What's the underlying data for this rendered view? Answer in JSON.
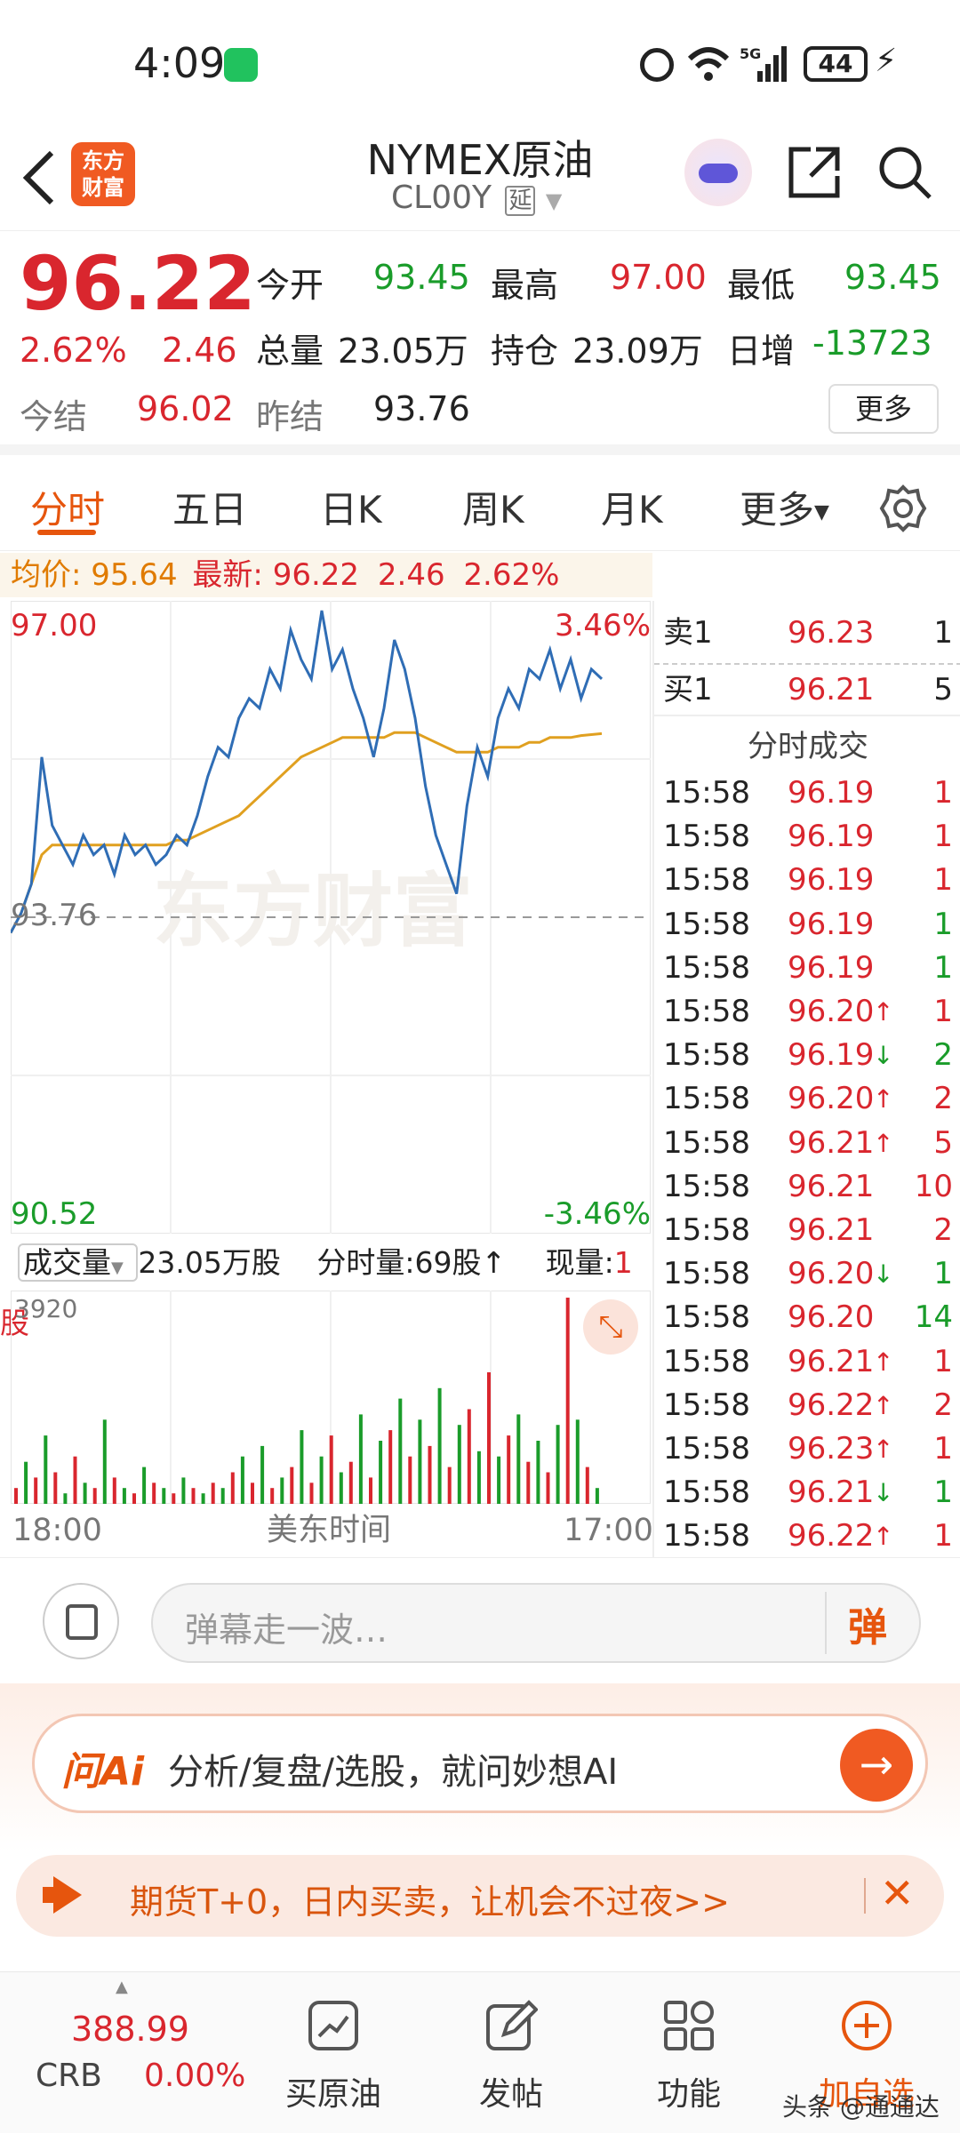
{
  "status": {
    "time": "4:09",
    "battery": "44"
  },
  "nav": {
    "logo_line1": "东方",
    "logo_line2": "财富",
    "title": "NYMEX原油",
    "subtitle": "CL00Y",
    "delay_tag": "延"
  },
  "quote": {
    "price": "96.22",
    "change_pct": "2.62%",
    "change": "2.46",
    "open_label": "今开",
    "open": "93.45",
    "high_label": "最高",
    "high": "97.00",
    "low_label": "最低",
    "low": "93.45",
    "volume_label": "总量",
    "volume": "23.05万",
    "oi_label": "持仓",
    "oi": "23.09万",
    "daily_inc_label": "日增",
    "daily_inc": "-13723",
    "settle_label": "今结",
    "settle": "96.02",
    "prev_settle_label": "昨结",
    "prev_settle": "93.76",
    "more_button": "更多"
  },
  "tabs": [
    "分时",
    "五日",
    "日K",
    "周K",
    "月K",
    "更多"
  ],
  "avg_bar": {
    "avg_label": "均价:",
    "avg_value": "95.64",
    "latest_label": "最新:",
    "latest_value": "96.22",
    "latest_change": "2.46",
    "latest_pct": "2.62%"
  },
  "chart_data": {
    "type": "line",
    "y_top_label": "97.00",
    "y_bottom_label": "90.52",
    "pct_top_label": "3.46%",
    "pct_bottom_label": "-3.46%",
    "baseline_label": "93.76",
    "ylim": [
      90.52,
      97.0
    ],
    "watermark": "东方财富",
    "series": [
      {
        "values": [
          93.6,
          93.8,
          94.1,
          95.4,
          94.7,
          94.5,
          94.3,
          94.6,
          94.4,
          94.5,
          94.2,
          94.6,
          94.4,
          94.5,
          94.3,
          94.4,
          94.6,
          94.5,
          94.8,
          95.2,
          95.5,
          95.4,
          95.8,
          96.0,
          95.9,
          96.3,
          96.1,
          96.7,
          96.4,
          96.2,
          96.9,
          96.3,
          96.5,
          96.1,
          95.8,
          95.4,
          95.9,
          96.6,
          96.3,
          95.8,
          95.1,
          94.6,
          94.3,
          94.0,
          94.9,
          95.5,
          95.2,
          95.8,
          96.1,
          95.9,
          96.3,
          96.2,
          96.5,
          96.1,
          96.4,
          96.0,
          96.3,
          96.2
        ]
      },
      {
        "values": [
          93.6,
          93.8,
          94.1,
          94.4,
          94.5,
          94.5,
          94.5,
          94.5,
          94.5,
          94.5,
          94.5,
          94.5,
          94.5,
          94.5,
          94.5,
          94.5,
          94.55,
          94.55,
          94.6,
          94.65,
          94.7,
          94.75,
          94.8,
          94.9,
          95.0,
          95.1,
          95.2,
          95.3,
          95.4,
          95.45,
          95.5,
          95.55,
          95.6,
          95.6,
          95.6,
          95.6,
          95.6,
          95.65,
          95.65,
          95.65,
          95.6,
          95.55,
          95.5,
          95.45,
          95.45,
          95.45,
          95.45,
          95.5,
          95.5,
          95.5,
          95.55,
          95.55,
          95.6,
          95.6,
          95.6,
          95.62,
          95.63,
          95.64
        ]
      }
    ],
    "volume": {
      "header_label": "成交量",
      "total": "23.05万股",
      "tick_label": "分时量:",
      "tick_value": "69股",
      "tick_arrow": "↑",
      "now_label": "现量:",
      "now_value": "1股",
      "max_label": "3920",
      "bars": [
        300,
        800,
        500,
        1300,
        600,
        200,
        900,
        400,
        300,
        1600,
        500,
        300,
        200,
        700,
        400,
        300,
        200,
        500,
        300,
        200,
        400,
        300,
        600,
        900,
        400,
        1100,
        300,
        500,
        700,
        1400,
        400,
        900,
        1300,
        600,
        800,
        1700,
        500,
        1200,
        1400,
        2000,
        900,
        1600,
        1100,
        2200,
        700,
        1500,
        1800,
        1000,
        2500,
        900,
        1300,
        1700,
        800,
        1200,
        600,
        1500,
        4000,
        1600,
        700,
        300
      ]
    },
    "x_start": "18:00",
    "x_mid": "美东时间",
    "x_end": "17:00"
  },
  "book": {
    "sell_label": "卖1",
    "sell_price": "96.23",
    "sell_qty": "1",
    "buy_label": "买1",
    "buy_price": "96.21",
    "buy_qty": "5",
    "ticks_title": "分时成交",
    "ticks": [
      {
        "time": "15:58",
        "price": "96.19",
        "arrow": "",
        "qty": "1",
        "qcolor": "red"
      },
      {
        "time": "15:58",
        "price": "96.19",
        "arrow": "",
        "qty": "1",
        "qcolor": "red"
      },
      {
        "time": "15:58",
        "price": "96.19",
        "arrow": "",
        "qty": "1",
        "qcolor": "red"
      },
      {
        "time": "15:58",
        "price": "96.19",
        "arrow": "",
        "qty": "1",
        "qcolor": "green"
      },
      {
        "time": "15:58",
        "price": "96.19",
        "arrow": "",
        "qty": "1",
        "qcolor": "green"
      },
      {
        "time": "15:58",
        "price": "96.20",
        "arrow": "↑",
        "qty": "1",
        "qcolor": "red"
      },
      {
        "time": "15:58",
        "price": "96.19",
        "arrow": "↓",
        "qty": "2",
        "qcolor": "green"
      },
      {
        "time": "15:58",
        "price": "96.20",
        "arrow": "↑",
        "qty": "2",
        "qcolor": "red"
      },
      {
        "time": "15:58",
        "price": "96.21",
        "arrow": "↑",
        "qty": "5",
        "qcolor": "red"
      },
      {
        "time": "15:58",
        "price": "96.21",
        "arrow": "",
        "qty": "10",
        "qcolor": "red"
      },
      {
        "time": "15:58",
        "price": "96.21",
        "arrow": "",
        "qty": "2",
        "qcolor": "red"
      },
      {
        "time": "15:58",
        "price": "96.20",
        "arrow": "↓",
        "qty": "1",
        "qcolor": "green"
      },
      {
        "time": "15:58",
        "price": "96.20",
        "arrow": "",
        "qty": "14",
        "qcolor": "green"
      },
      {
        "time": "15:58",
        "price": "96.21",
        "arrow": "↑",
        "qty": "1",
        "qcolor": "red"
      },
      {
        "time": "15:58",
        "price": "96.22",
        "arrow": "↑",
        "qty": "2",
        "qcolor": "red"
      },
      {
        "time": "15:58",
        "price": "96.23",
        "arrow": "↑",
        "qty": "1",
        "qcolor": "red"
      },
      {
        "time": "15:58",
        "price": "96.21",
        "arrow": "↓",
        "qty": "1",
        "qcolor": "green"
      },
      {
        "time": "15:58",
        "price": "96.22",
        "arrow": "↑",
        "qty": "1",
        "qcolor": "red"
      }
    ]
  },
  "comment": {
    "placeholder": "弹幕走一波…",
    "danmu_button": "弹"
  },
  "ai": {
    "logo": "问Ai",
    "text": "分析/复盘/选股，就问妙想AI"
  },
  "promo": {
    "text": "期货T+0，日内买卖，让机会不过夜>>"
  },
  "bottom": {
    "crb_value": "388.99",
    "crb_label": "CRB",
    "crb_change": "0.00%",
    "items": [
      "买原油",
      "发帖",
      "功能",
      "加自选"
    ],
    "watermark": "头条 @通通达"
  },
  "colors": {
    "up": "#d9262e",
    "down": "#1a9c2a",
    "accent": "#e6550d",
    "price_line": "#2f6db5",
    "avg_line": "#e0a020"
  }
}
